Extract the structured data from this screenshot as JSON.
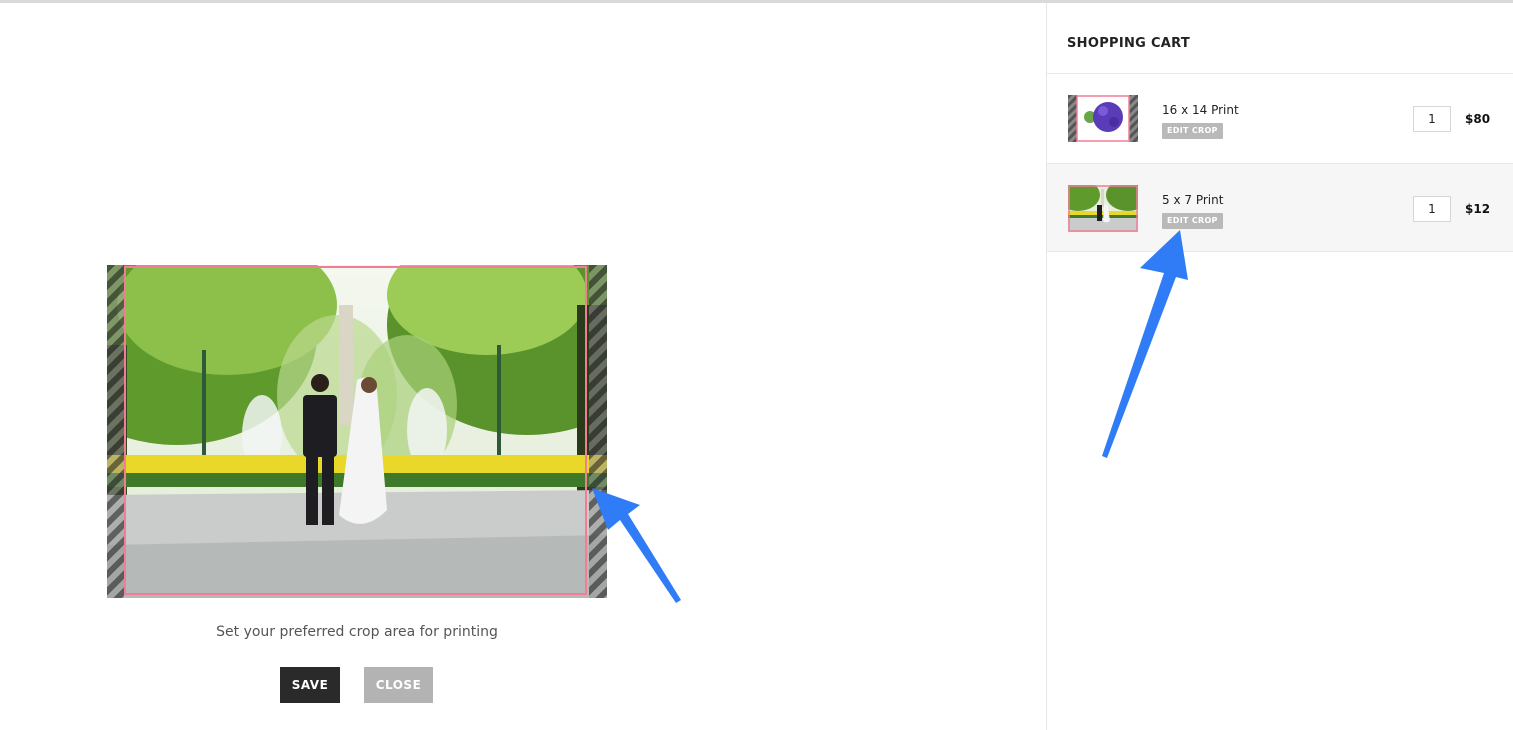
{
  "editor": {
    "caption": "Set your preferred crop area for printing",
    "save_label": "SAVE",
    "close_label": "CLOSE"
  },
  "cart": {
    "title": "SHOPPING CART",
    "items": [
      {
        "name": "16 x 14 Print",
        "edit_label": "EDIT CROP",
        "quantity": "1",
        "price": "$80"
      },
      {
        "name": "5 x 7 Print",
        "edit_label": "EDIT CROP",
        "quantity": "1",
        "price": "$12"
      }
    ]
  },
  "colors": {
    "crop_border": "#f07f95",
    "annotation_arrow": "#2f7cf6",
    "save_button": "#2a2a2a",
    "close_button": "#b3b3b3"
  },
  "icons": [
    "annotation-arrow-icon"
  ]
}
